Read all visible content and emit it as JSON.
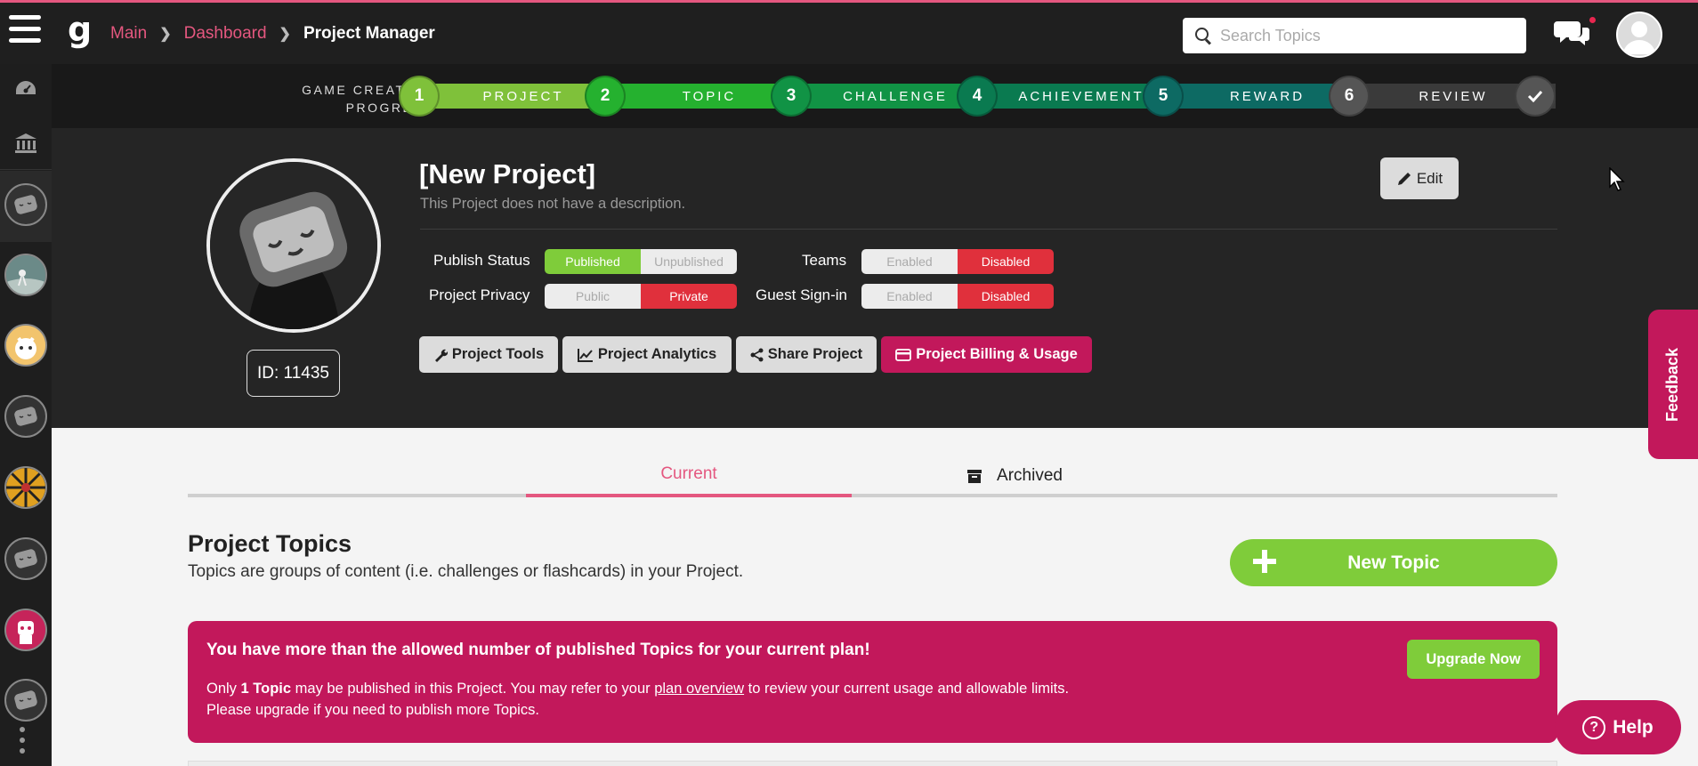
{
  "breadcrumb": {
    "main": "Main",
    "dashboard": "Dashboard",
    "current": "Project Manager"
  },
  "search": {
    "placeholder": "Search Topics"
  },
  "progress": {
    "label_line1": "GAME CREATION",
    "label_line2": "PROGRESS",
    "steps": [
      {
        "number": "1",
        "label": "PROJECT",
        "color": "#7fc13a"
      },
      {
        "number": "2",
        "label": "TOPIC",
        "color": "#25b12f"
      },
      {
        "number": "3",
        "label": "CHALLENGE",
        "color": "#119345"
      },
      {
        "number": "4",
        "label": "ACHIEVEMENT",
        "color": "#0a7a50"
      },
      {
        "number": "5",
        "label": "REWARD",
        "color": "#0d6a63"
      },
      {
        "number": "6",
        "label": "REVIEW",
        "color": "#3a3a3a"
      }
    ],
    "final_icon": "checkmark-icon"
  },
  "project": {
    "title": "[New Project]",
    "description": "This Project does not have a description.",
    "id_text": "ID: 11435",
    "edit_label": "Edit",
    "publish_status": {
      "label": "Publish Status",
      "option_on": "Published",
      "option_off": "Unpublished",
      "selected": "Published"
    },
    "project_privacy": {
      "label": "Project Privacy",
      "option_left": "Public",
      "option_right": "Private",
      "selected": "Private"
    },
    "teams": {
      "label": "Teams",
      "option_left": "Enabled",
      "option_right": "Disabled",
      "selected": "Disabled"
    },
    "guest_signin": {
      "label": "Guest Sign-in",
      "option_left": "Enabled",
      "option_right": "Disabled",
      "selected": "Disabled"
    },
    "tools": {
      "project_tools": "Project Tools",
      "project_analytics": "Project Analytics",
      "share_project": "Share Project",
      "billing": "Project Billing & Usage"
    }
  },
  "feedback": {
    "label": "Feedback"
  },
  "tabs": {
    "current": "Current",
    "archived": "Archived",
    "active": "Current"
  },
  "topics": {
    "title": "Project Topics",
    "subtitle": "Topics are groups of content (i.e. challenges or flashcards) in your Project.",
    "new_topic_label": "New Topic"
  },
  "alert": {
    "title": "You have more than the allowed number of published Topics for your current plan!",
    "line1_prefix": "Only ",
    "line1_bold": "1 Topic",
    "line1_middle": " may be published in this Project. You may refer to your ",
    "line1_link": "plan overview",
    "line1_suffix": " to review your current usage and allowable limits.",
    "line2": "Please upgrade if you need to publish more Topics.",
    "upgrade_label": "Upgrade Now"
  },
  "help": {
    "label": "Help"
  },
  "colors": {
    "accent_pink": "#e4577f",
    "brand_magenta": "#c2185b",
    "green": "#7fcc3a",
    "red": "#e0303c"
  }
}
